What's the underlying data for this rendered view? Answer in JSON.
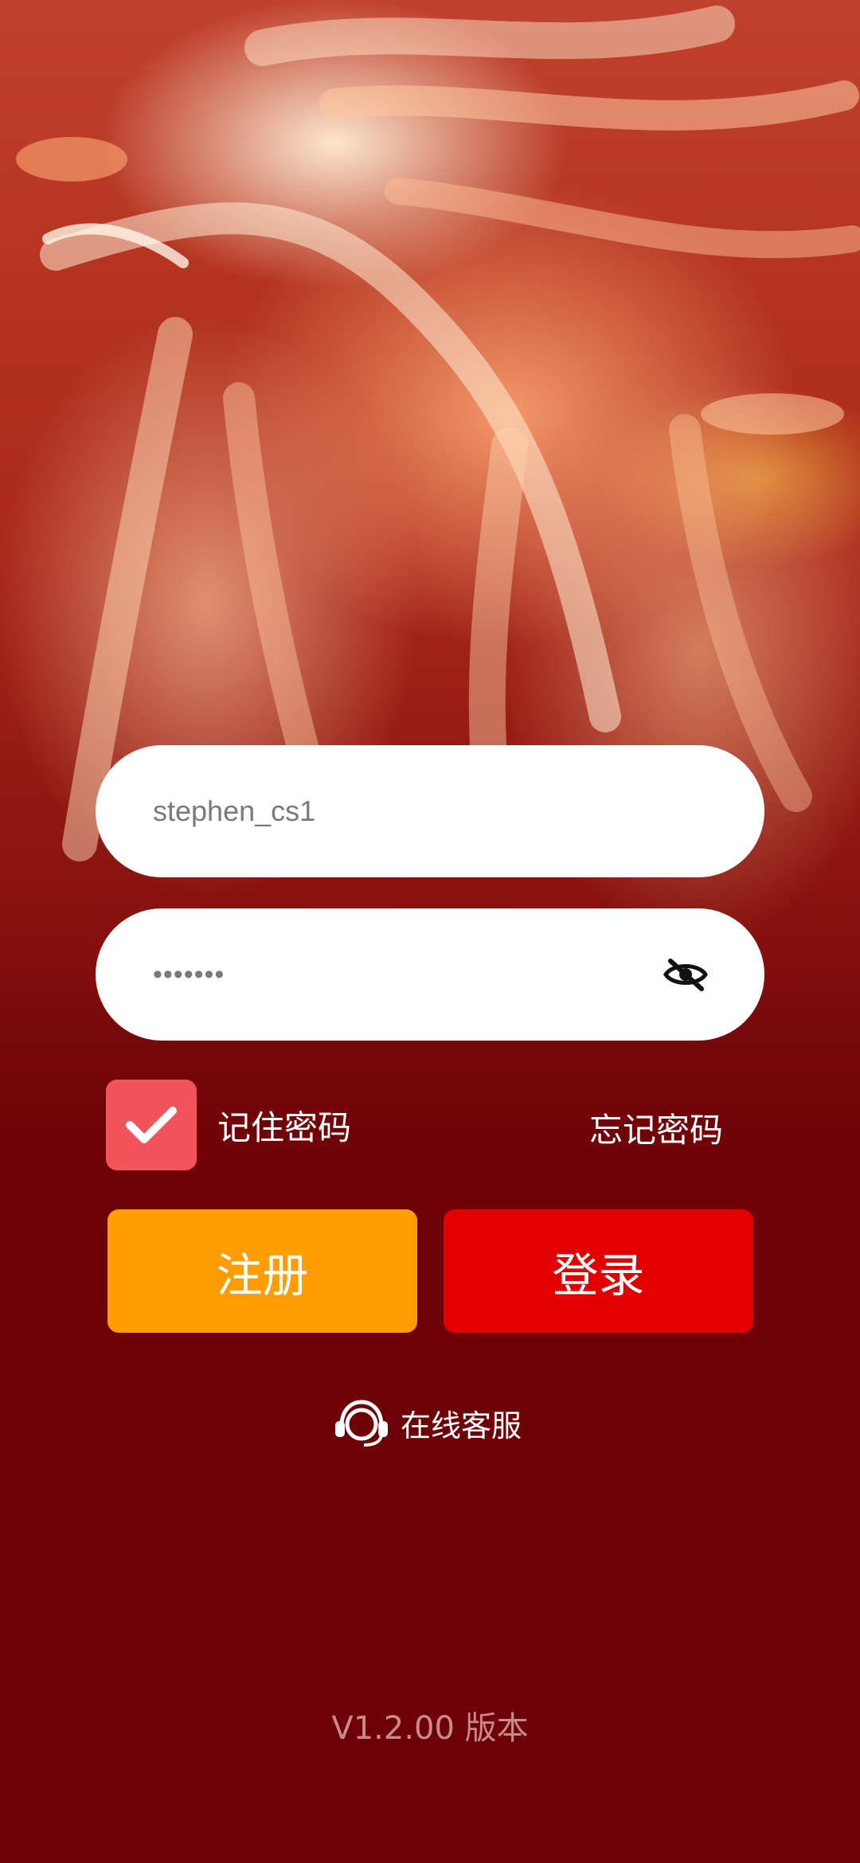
{
  "login_form": {
    "username_value": "stephen_cs1",
    "password_value": "•••••••",
    "remember_password_label": "记住密码",
    "remember_checked": true,
    "forgot_password_label": "忘记密码",
    "register_label": "注册",
    "login_label": "登录"
  },
  "support": {
    "label": "在线客服",
    "icon": "headset-icon"
  },
  "footer": {
    "version": "V1.2.00 版本"
  },
  "colors": {
    "register_button": "#ff9d00",
    "login_button": "#e20000",
    "checkbox": "#f2545b",
    "background": "#6e0007"
  }
}
